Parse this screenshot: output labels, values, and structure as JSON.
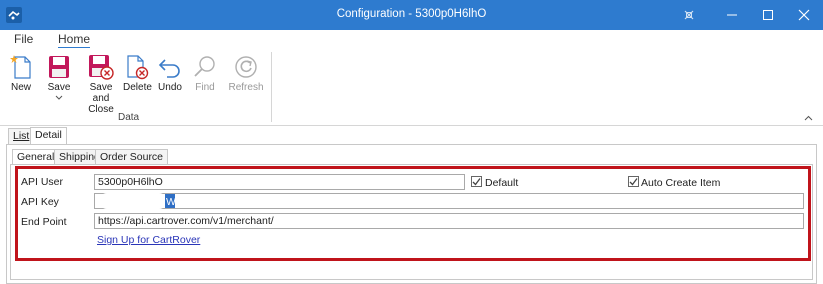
{
  "window": {
    "title": "Configuration - 5300p0H6lhO"
  },
  "menu": {
    "file": "File",
    "home": "Home"
  },
  "ribbon": {
    "new": "New",
    "save": "Save",
    "save_and_close_line1": "Save and",
    "save_and_close_line2": "Close",
    "delete": "Delete",
    "undo": "Undo",
    "find": "Find",
    "refresh": "Refresh",
    "group_label": "Data"
  },
  "tabs": {
    "list": "List",
    "detail": "Detail"
  },
  "subtabs": {
    "general": "General",
    "shipping": "Shipping",
    "order_source": "Order Source"
  },
  "form": {
    "api_user_label": "API User",
    "api_user_value": "5300p0H6lhO",
    "default_label": "Default",
    "default_checked": true,
    "auto_create_label": "Auto Create Item",
    "auto_create_checked": true,
    "api_key_label": "API Key",
    "api_key_visible": "WZ",
    "end_point_label": "End Point",
    "end_point_value": "https://api.cartrover.com/v1/merchant/",
    "signup_link": "Sign Up for CartRover"
  },
  "colors": {
    "titlebar": "#2e7bcf",
    "highlight": "#c0141b",
    "link": "#2a35b8",
    "selection": "#2f6fc5"
  }
}
